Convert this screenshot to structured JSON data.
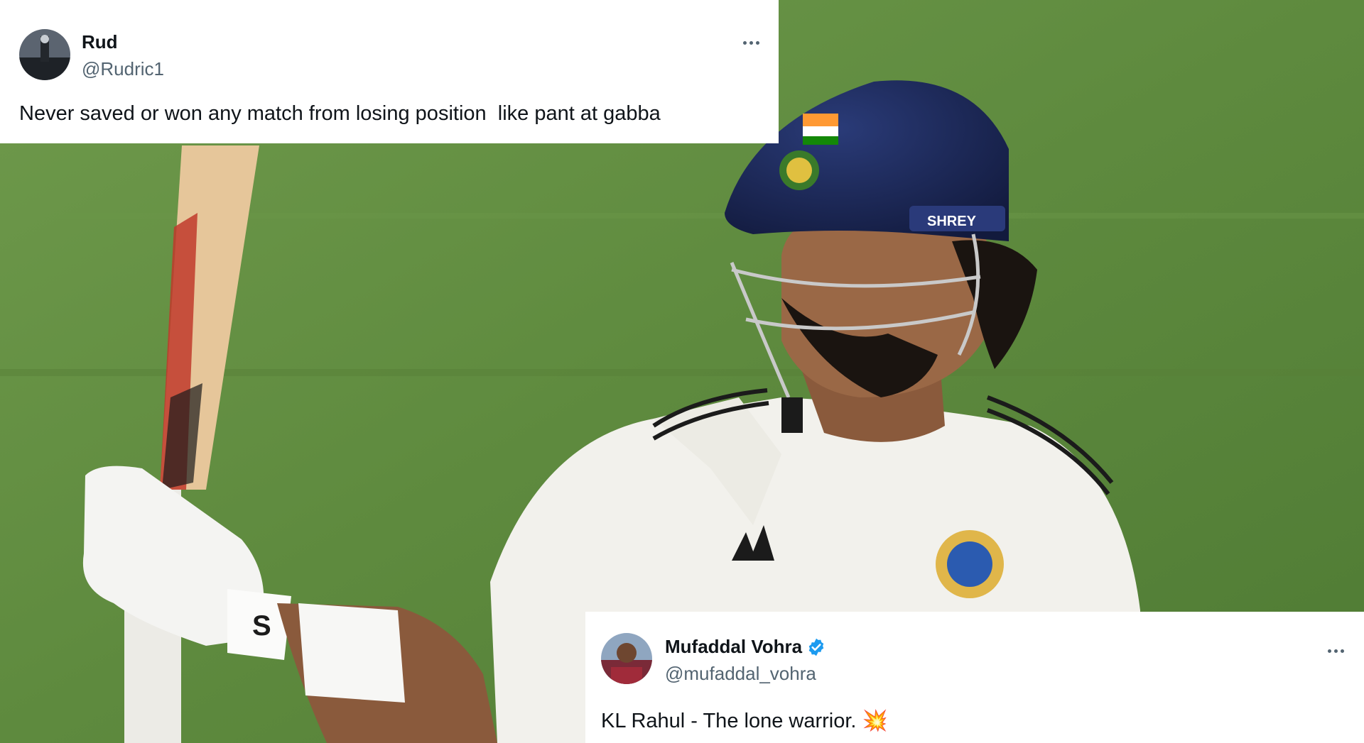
{
  "top_tweet": {
    "display_name": "Rud",
    "handle": "@Rudric1",
    "text": "Never saved or won any match from losing position  like pant at gabba",
    "more_icon": "more-horizontal-icon"
  },
  "bottom_tweet": {
    "display_name": "Mufaddal Vohra",
    "verified": true,
    "handle": "@mufaddal_vohra",
    "text": "KL Rahul - The lone warrior.",
    "emoji": "💥",
    "more_icon": "more-horizontal-icon"
  },
  "photo": {
    "helmet_label": "SHREY",
    "glove_logo": "S"
  },
  "colors": {
    "field_green": "#5e8a3e",
    "helmet_blue": "#1c2a5c",
    "jersey_white": "#f2f1ec",
    "verified_blue": "#1d9bf0",
    "text_primary": "#0f1419",
    "text_secondary": "#536471"
  }
}
